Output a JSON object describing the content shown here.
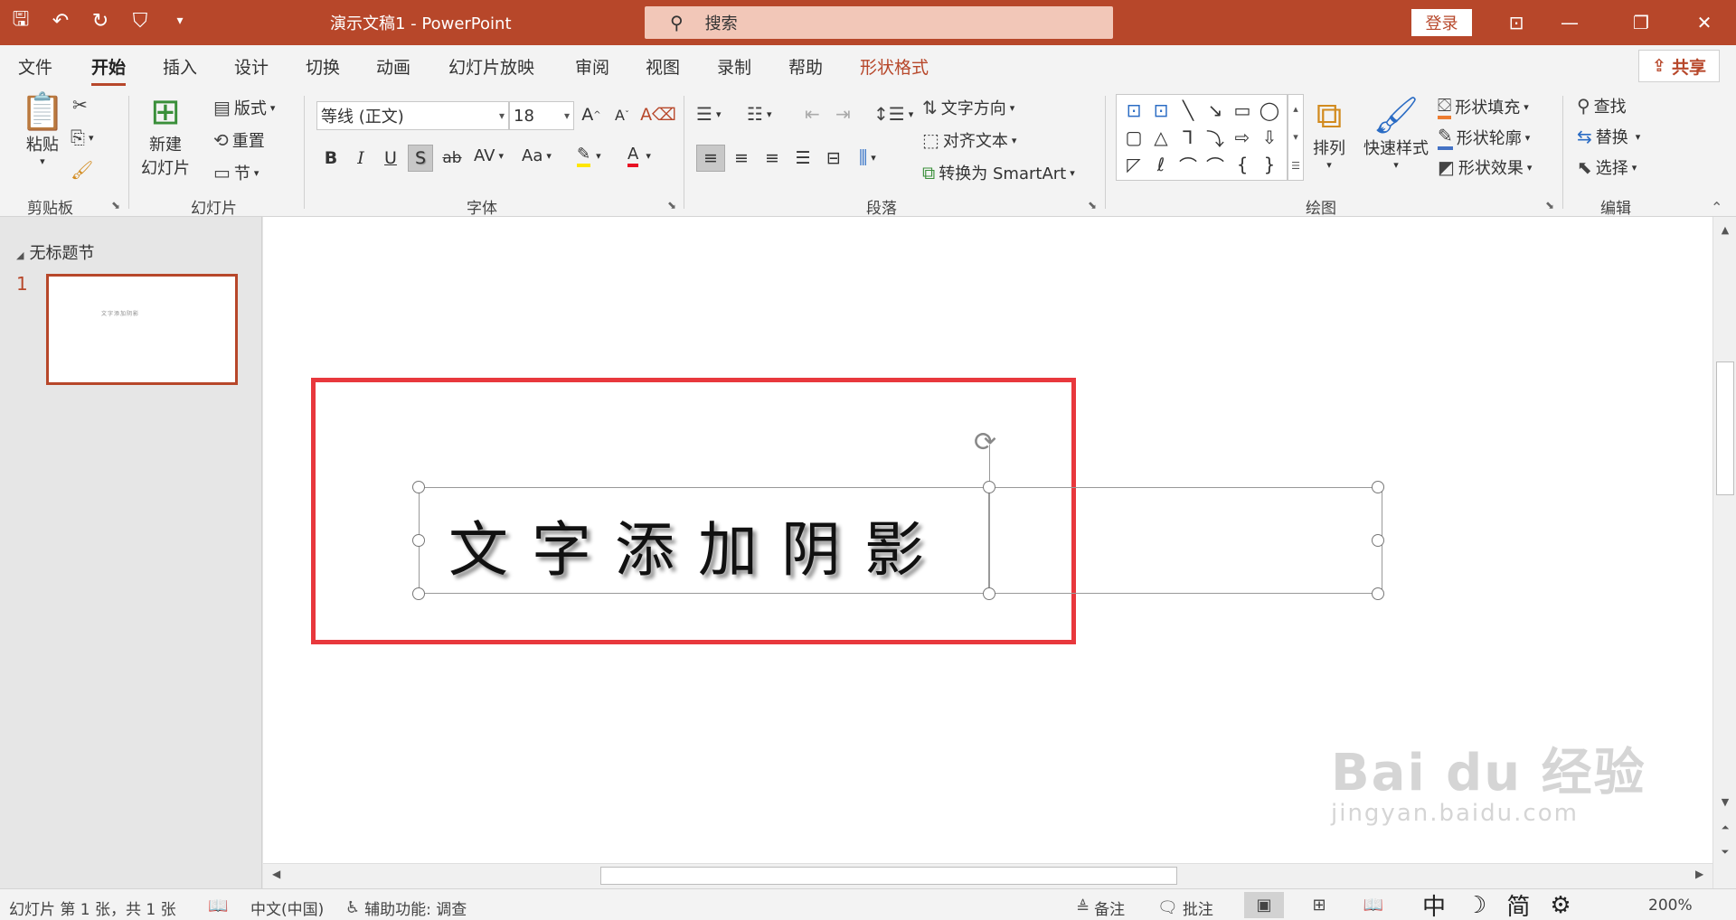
{
  "titlebar": {
    "title": "演示文稿1  -  PowerPoint",
    "search_placeholder": "搜索",
    "login": "登录",
    "color": "#b7472a"
  },
  "tabs": [
    {
      "label": "文件"
    },
    {
      "label": "开始",
      "active": true
    },
    {
      "label": "插入"
    },
    {
      "label": "设计"
    },
    {
      "label": "切换"
    },
    {
      "label": "动画"
    },
    {
      "label": "幻灯片放映"
    },
    {
      "label": "审阅"
    },
    {
      "label": "视图"
    },
    {
      "label": "录制"
    },
    {
      "label": "帮助"
    },
    {
      "label": "形状格式",
      "contextual": true
    }
  ],
  "share": "共享",
  "ribbon": {
    "clipboard": {
      "label": "剪贴板",
      "paste": "粘贴"
    },
    "slides": {
      "label": "幻灯片",
      "new_slide_line1": "新建",
      "new_slide_line2": "幻灯片",
      "layout": "版式",
      "reset": "重置",
      "section": "节"
    },
    "font": {
      "label": "字体",
      "font_name": "等线 (正文)",
      "font_size": "18",
      "bold": "B",
      "italic": "I",
      "underline": "U",
      "shadow": "S",
      "strike": "ab",
      "spacing": "AV",
      "case": "Aa",
      "grow": "A",
      "shrink": "A",
      "color_underline": "#e81123",
      "highlight_underline": "#ffe600"
    },
    "paragraph": {
      "label": "段落",
      "text_direction": "文字方向",
      "align_text": "对齐文本",
      "smartart": "转换为 SmartArt"
    },
    "drawing": {
      "label": "绘图",
      "arrange": "排列",
      "quick_styles": "快速样式",
      "shape_fill": "形状填充",
      "shape_outline": "形状轮廓",
      "shape_effects": "形状效果"
    },
    "editing": {
      "label": "编辑",
      "find": "查找",
      "replace": "替换",
      "select": "选择"
    }
  },
  "leftpane": {
    "section": "无标题节",
    "slide_number": "1",
    "thumb_text": "文字添加阴影"
  },
  "slide": {
    "text": "文字添加阴影",
    "highlight_color": "#e8383d"
  },
  "statusbar": {
    "slide_info": "幻灯片 第 1 张，共 1 张",
    "language": "中文(中国)",
    "accessibility": "辅助功能: 调查",
    "notes": "备注",
    "comments": "批注",
    "ime_chars": [
      "中",
      "简"
    ],
    "zoom": "200%"
  },
  "watermark": {
    "main": "Bai du 经验",
    "sub": "jingyan.baidu.com"
  }
}
